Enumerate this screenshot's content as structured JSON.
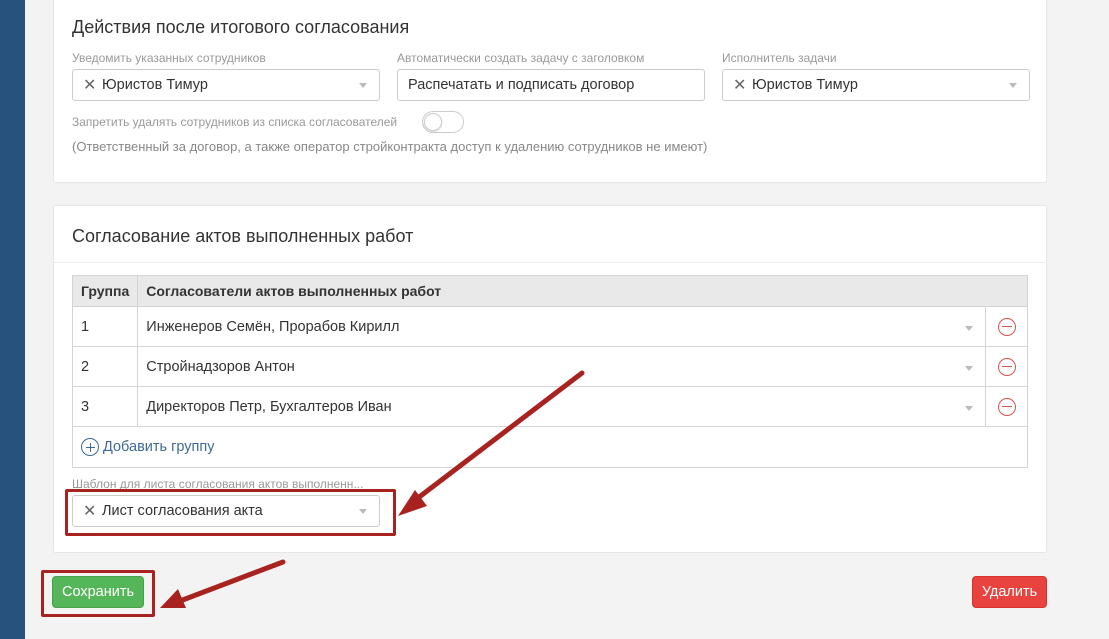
{
  "section_final": {
    "title": "Действия после итогового согласования",
    "notify_label": "Уведомить указанных сотрудников",
    "notify_value": "Юристов Тимур",
    "task_title_label": "Автоматически создать задачу с заголовком",
    "task_title_value": "Распечатать и подписать договор",
    "executor_label": "Исполнитель задачи",
    "executor_value": "Юристов Тимур",
    "forbid_label": "Запретить удалять сотрудников из списка согласователей",
    "forbid_toggle_on": false,
    "note": "(Ответственный за договор, а также оператор стройконтракта доступ к удалению сотрудников не имеют)"
  },
  "section_acts": {
    "title": "Согласование актов выполненных работ",
    "table": {
      "headers": [
        "Группа",
        "Согласователи актов выполненных работ"
      ],
      "rows": [
        {
          "group": "1",
          "approvers": "Инженеров Семён, Прорабов Кирилл"
        },
        {
          "group": "2",
          "approvers": "Стройнадзоров Антон"
        },
        {
          "group": "3",
          "approvers": "Директоров Петр, Бухгалтеров Иван"
        }
      ]
    },
    "add_group_label": "Добавить группу",
    "template_label": "Шаблон для листа согласования актов выполненн...",
    "template_value": "Лист согласования акта"
  },
  "actions": {
    "save_label": "Сохранить",
    "delete_label": "Удалить"
  },
  "colors": {
    "sidebar": "#27527e",
    "save": "#55b559",
    "delete": "#e8433e",
    "annotation": "#a8231f",
    "link": "#3d6a96"
  },
  "icons": {
    "clear": "close-icon",
    "remove_row": "minus-circle-icon",
    "add_group": "plus-circle-icon"
  }
}
